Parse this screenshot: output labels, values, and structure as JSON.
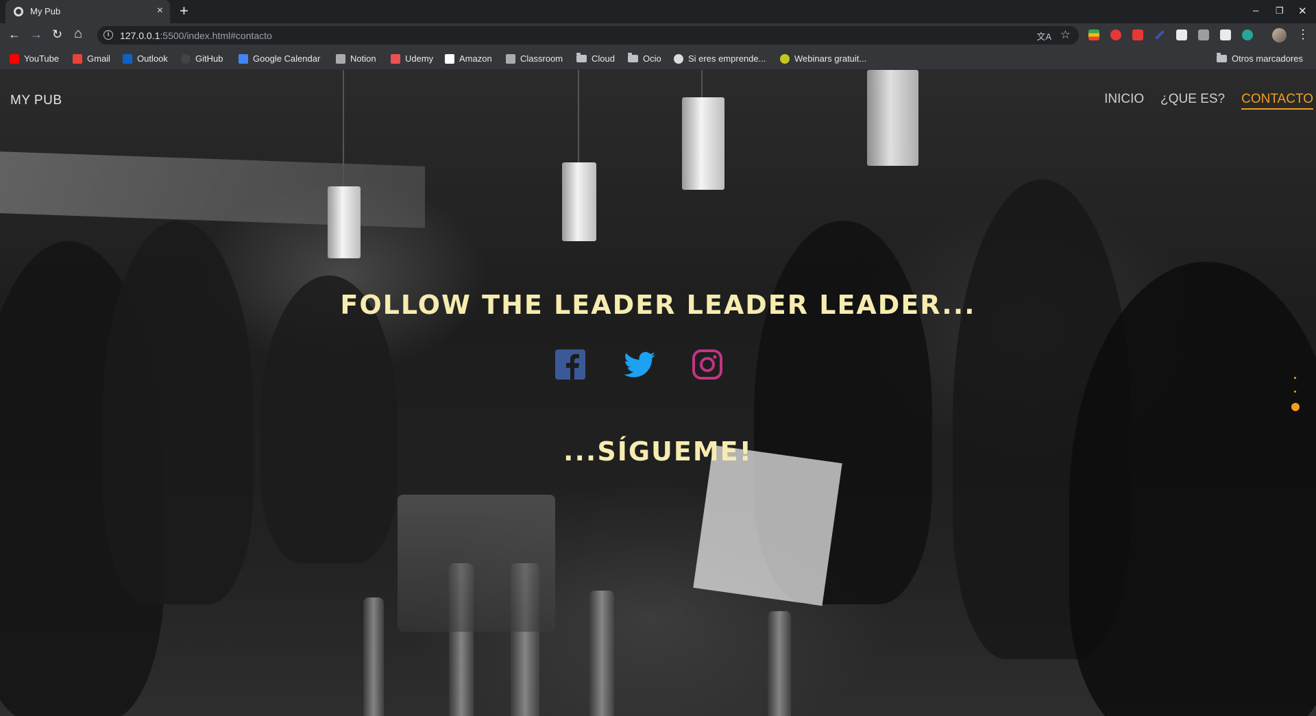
{
  "browser": {
    "tab_title": "My Pub",
    "tab_close": "×",
    "new_tab": "+",
    "url_host": "127.0.0.1",
    "url_rest": ":5500/index.html#contacto",
    "window_controls": {
      "minimize": "–",
      "restore": "❐",
      "close": "✕"
    },
    "nav": {
      "back": "←",
      "forward": "→",
      "reload": "↻",
      "home": "⌂"
    },
    "bookmarks": [
      {
        "label": "YouTube",
        "icon": "youtube-icon",
        "color": "#ff0000"
      },
      {
        "label": "Gmail",
        "icon": "gmail-icon",
        "color": "#ea4335"
      },
      {
        "label": "Outlook",
        "icon": "outlook-icon",
        "color": "#0a64c8"
      },
      {
        "label": "GitHub",
        "icon": "github-icon",
        "color": "#444444"
      },
      {
        "label": "Google Calendar",
        "icon": "calendar-icon",
        "color": "#4285f4"
      },
      {
        "label": "Notion",
        "icon": "notion-icon",
        "color": "#aaaaaa"
      },
      {
        "label": "Udemy",
        "icon": "udemy-icon",
        "color": "#ec5252"
      },
      {
        "label": "Amazon",
        "icon": "amazon-icon",
        "color": "#ffffff"
      },
      {
        "label": "Classroom",
        "icon": "classroom-icon",
        "color": "#aaaaaa"
      },
      {
        "label": "Cloud",
        "icon": "folder-icon",
        "color": "#bdc1c6"
      },
      {
        "label": "Ocio",
        "icon": "folder-icon",
        "color": "#bdc1c6"
      },
      {
        "label": "Si eres emprende...",
        "icon": "globe-icon",
        "color": "#dadce0"
      },
      {
        "label": "Webinars gratuit...",
        "icon": "webinar-icon",
        "color": "#c6c61f"
      }
    ],
    "other_bookmarks": "Otros marcadores"
  },
  "site": {
    "brand": "MY PUB",
    "nav": [
      {
        "label": "INICIO",
        "active": false
      },
      {
        "label": "¿QUE ES?",
        "active": false
      },
      {
        "label": "CONTACTO",
        "active": true
      }
    ],
    "hero_title": "FOLLOW THE LEADER LEADER LEADER...",
    "hero_sub": "...SÍGUEME!",
    "social": [
      {
        "name": "facebook-icon",
        "color": "#3b5998"
      },
      {
        "name": "twitter-icon",
        "color": "#1da1f2"
      },
      {
        "name": "instagram-icon",
        "color": "#c13584"
      }
    ],
    "accent_color": "#f0a020",
    "title_color": "#f7ecb0"
  }
}
